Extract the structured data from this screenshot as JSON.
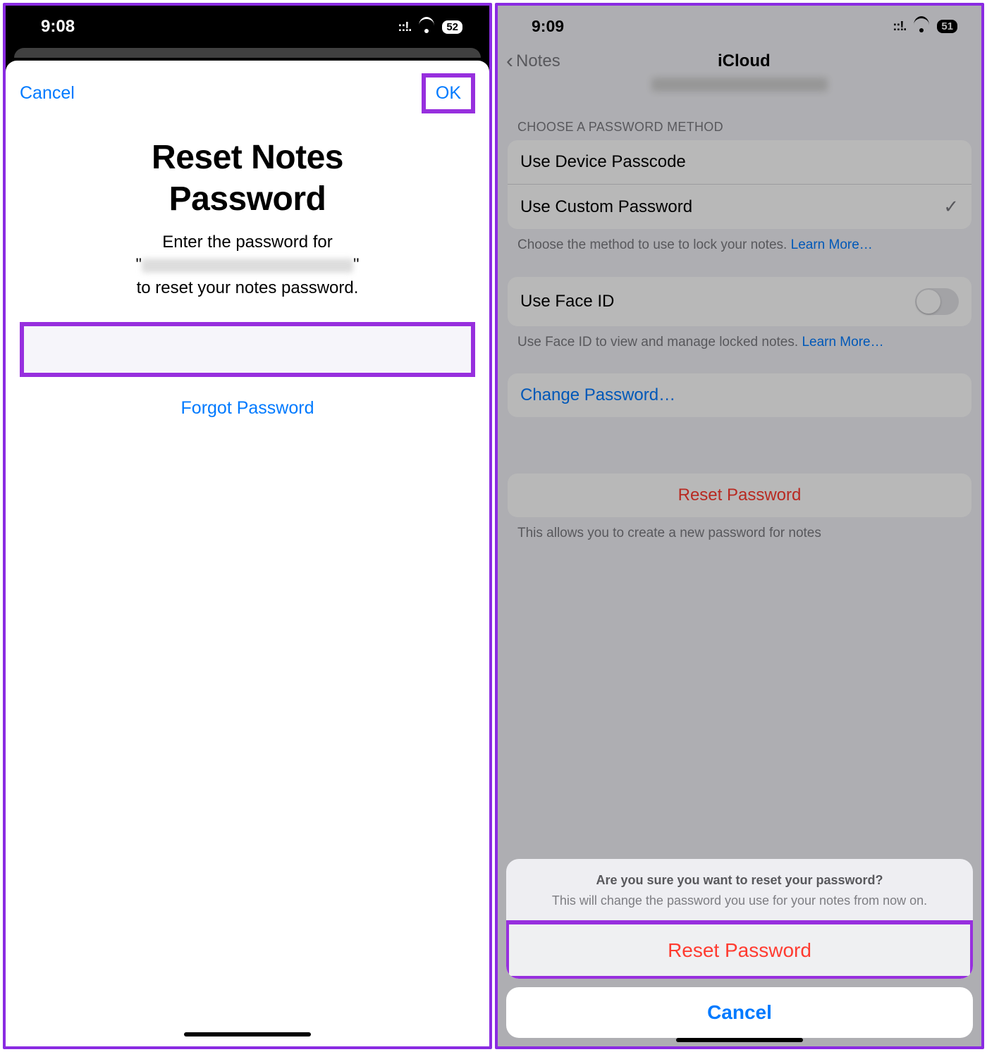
{
  "left": {
    "status": {
      "time": "9:08",
      "battery": "52"
    },
    "nav": {
      "cancel": "Cancel",
      "ok": "OK"
    },
    "title_l1": "Reset Notes",
    "title_l2": "Password",
    "desc_l1": "Enter the password for",
    "desc_l3": "to reset your notes password.",
    "forgot": "Forgot Password"
  },
  "right": {
    "status": {
      "time": "9:09",
      "battery": "51"
    },
    "back": "Notes",
    "title": "iCloud",
    "section_method": "CHOOSE A PASSWORD METHOD",
    "method1": "Use Device Passcode",
    "method2": "Use Custom Password",
    "method_footer": "Choose the method to use to lock your notes. ",
    "learn_more": "Learn More…",
    "faceid_label": "Use Face ID",
    "faceid_footer": "Use Face ID to view and manage locked notes. ",
    "change_pw": "Change Password…",
    "reset_pw": "Reset Password",
    "reset_footer": "This allows you to create a new password for notes",
    "sheet": {
      "question": "Are you sure you want to reset your password?",
      "subtitle": "This will change the password you use for your notes from now on.",
      "action": "Reset Password",
      "cancel": "Cancel"
    }
  }
}
